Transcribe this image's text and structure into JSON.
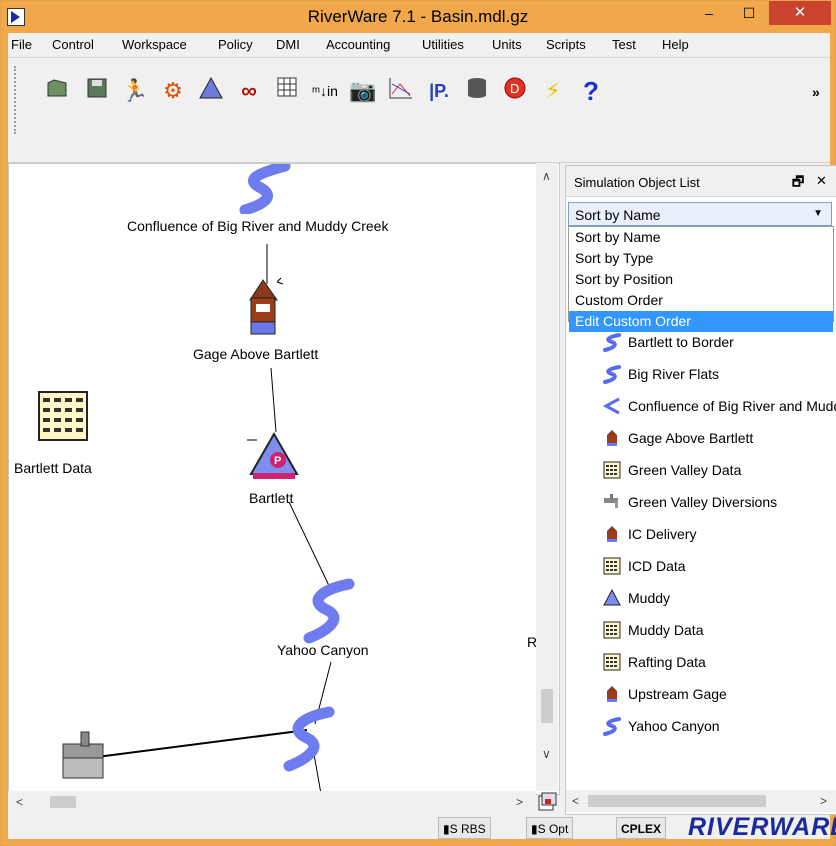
{
  "window": {
    "title": "RiverWare 7.1 - Basin.mdl.gz",
    "min_glyph": "‒",
    "max_glyph": "☐",
    "close_glyph": "✕"
  },
  "menu": [
    "File",
    "Control",
    "Workspace",
    "Policy",
    "DMI",
    "Accounting",
    "Utilities",
    "Units",
    "Scripts",
    "Test",
    "Help"
  ],
  "toolbar": {
    "tools": [
      "open-icon",
      "save-icon",
      "run-icon",
      "step-icon",
      "reservoir-icon",
      "link-icon",
      "grid-icon",
      "input-icon",
      "camera-icon",
      "plot-icon",
      "policy-icon",
      "database-icon",
      "diagnostics-icon",
      "lightning-icon",
      "help-icon"
    ],
    "more": "»"
  },
  "workspace": {
    "nodes": [
      {
        "label": "Confluence of Big River and Muddy Creek"
      },
      {
        "label": "Gage Above Bartlett"
      },
      {
        "label": "Bartlett Data"
      },
      {
        "label": "Bartlett"
      },
      {
        "label": "Yahoo Canyon"
      },
      {
        "label": "R"
      }
    ]
  },
  "panel": {
    "title": "Simulation Object List",
    "float_glyph": "🗗",
    "close_glyph": "✕",
    "sort_selected": "Sort by Name",
    "sort_options": [
      "Sort by Name",
      "Sort by Type",
      "Sort by Position",
      "Custom Order",
      "Edit Custom Order"
    ],
    "items": [
      {
        "label": "Bartlett to Border",
        "icon": "reach-icon"
      },
      {
        "label": "Big River Flats",
        "icon": "reach-icon"
      },
      {
        "label": "Confluence of Big River and Muddy Creek",
        "icon": "confluence-icon"
      },
      {
        "label": "Gage Above Bartlett",
        "icon": "gage-icon"
      },
      {
        "label": "Green Valley Data",
        "icon": "data-icon"
      },
      {
        "label": "Green Valley Diversions",
        "icon": "diversion-icon"
      },
      {
        "label": "IC Delivery",
        "icon": "gage-icon"
      },
      {
        "label": "ICD Data",
        "icon": "data-icon"
      },
      {
        "label": "Muddy",
        "icon": "reservoir-icon"
      },
      {
        "label": "Muddy Data",
        "icon": "data-icon"
      },
      {
        "label": "Rafting Data",
        "icon": "data-icon"
      },
      {
        "label": "Upstream Gage",
        "icon": "gage-icon"
      },
      {
        "label": "Yahoo Canyon",
        "icon": "reach-icon"
      }
    ]
  },
  "status": {
    "rbs": "RBS",
    "opt": "Opt",
    "cplex": "CPLEX",
    "brand": "RIVERWARE"
  }
}
